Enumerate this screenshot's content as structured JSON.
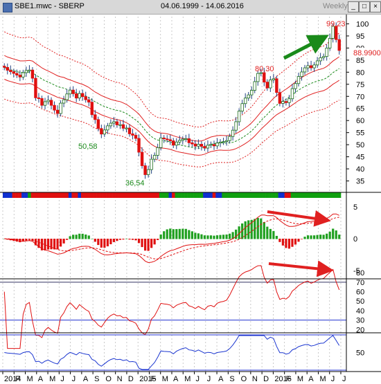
{
  "window": {
    "title": "SBE1.mwc - SBERP",
    "date_range": "04.06.1999 - 14.06.2016",
    "period": "Weekly",
    "buttons": [
      "_",
      "□",
      "×"
    ]
  },
  "chart_data": [
    {
      "type": "candlestick",
      "panel": "price",
      "ylim": [
        32,
        103
      ],
      "y_ticks": [
        "100",
        "95",
        "90",
        "85",
        "80",
        "75",
        "70",
        "65",
        "60",
        "55",
        "50",
        "45",
        "40",
        "35"
      ],
      "last_price_label": "88.9900",
      "annotations": [
        {
          "text": "99,23",
          "x": 124,
          "y": 99.23,
          "color": "#e02020"
        },
        {
          "text": "80,30",
          "x": 98,
          "y": 80.3,
          "color": "#e02020"
        },
        {
          "text": "50,58",
          "x": 30,
          "y": 50.58,
          "color": "#1a8a1a"
        },
        {
          "text": "36,54",
          "x": 51,
          "y": 36.54,
          "color": "#1a8a1a"
        }
      ],
      "arrows": [
        {
          "direction": "up",
          "color": "#1a8a1a"
        }
      ],
      "overlays": [
        "moving average (green dashed)",
        "inner envelope (red solid)",
        "outer envelope (red dotted)"
      ],
      "close_series": [
        82.0,
        80.8,
        80.2,
        79.5,
        78.8,
        78.0,
        79.8,
        80.7,
        80.9,
        77.5,
        69.4,
        69.1,
        66.3,
        67.8,
        68.4,
        66.3,
        64.3,
        62.9,
        67.2,
        68.6,
        71.0,
        72.6,
        71.1,
        69.3,
        71.2,
        69.9,
        68.6,
        67.6,
        62.4,
        60.4,
        56.7,
        54.4,
        56.1,
        57.8,
        58.9,
        59.5,
        58.2,
        58.3,
        56.8,
        56.9,
        54.5,
        53.9,
        52.6,
        46.9,
        41.3,
        37.6,
        39.7,
        44.0,
        45.6,
        48.8,
        52.8,
        52.4,
        52.1,
        51.6,
        49.8,
        51.1,
        51.8,
        52.3,
        52.5,
        50.8,
        50.3,
        49.4,
        50.2,
        49.3,
        48.6,
        49.8,
        50.1,
        49.5,
        50.7,
        51.1,
        51.3,
        51.7,
        53.4,
        56.0,
        59.5,
        63.9,
        67.0,
        69.3,
        70.6,
        72.5,
        76.1,
        79.5,
        79.8,
        75.9,
        73.5,
        76.8,
        77.3,
        71.6,
        67.1,
        67.9,
        67.4,
        69.0,
        73.2,
        75.3,
        78.2,
        80.1,
        81.8,
        82.7,
        81.8,
        83.0,
        84.7,
        86.0,
        86.5,
        90.0,
        94.0,
        99.0,
        93.5,
        88.99
      ],
      "x_range": "Jan 2014 - Jun 2016"
    },
    {
      "type": "bar",
      "panel": "MACD histogram",
      "ylim": [
        -5,
        5
      ],
      "y_ticks": [
        "5",
        "0",
        "-5"
      ],
      "series": [
        {
          "values": "one bar per week (red negative, green positive)"
        }
      ],
      "overlays": [
        "MACD line (red)",
        "signal line (red dashed)"
      ],
      "arrows": [
        {
          "direction": "down",
          "color": "#e02020"
        }
      ]
    },
    {
      "type": "line",
      "panel": "RSI",
      "ylim": [
        20,
        85
      ],
      "y_ticks": [
        "80",
        "70",
        "60",
        "50",
        "40",
        "30",
        "20"
      ],
      "levels": [
        70,
        30
      ],
      "arrows": [
        {
          "direction": "down",
          "color": "#e02020"
        }
      ]
    },
    {
      "type": "line",
      "panel": "oscillator",
      "y_ticks": [
        "50"
      ],
      "levels": [
        "upper band",
        "lower band"
      ]
    },
    {
      "type": "axis",
      "x_tick_labels": [
        "2014",
        "F",
        "M",
        "A",
        "M",
        "J",
        "J",
        "A",
        "S",
        "O",
        "N",
        "D",
        "2015",
        "F",
        "M",
        "A",
        "M",
        "J",
        "J",
        "A",
        "S",
        "O",
        "N",
        "D",
        "2016",
        "F",
        "M",
        "A",
        "M",
        "J",
        "J"
      ]
    }
  ],
  "colors": {
    "up": "#1a6a1a",
    "down": "#e01010",
    "ma": "#1a8a1a",
    "envelope": "#e02020",
    "oscillator": "#1a35d0",
    "grid": "#bbbbbb"
  }
}
